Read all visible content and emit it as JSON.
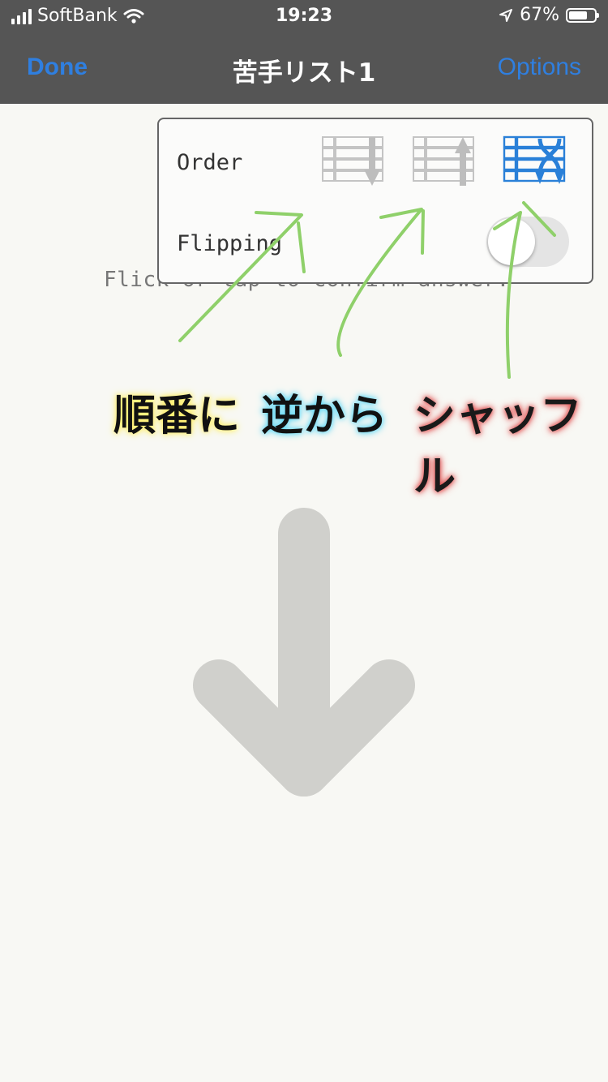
{
  "status_bar": {
    "carrier": "SoftBank",
    "time": "19:23",
    "battery": "67%"
  },
  "nav": {
    "done_label": "Done",
    "title": "苦手リスト1",
    "options_label": "Options"
  },
  "hint_text": "Flick or tap to confirm answer.",
  "popover": {
    "order_label": "Order",
    "flipping_label": "Flipping",
    "order_options": [
      "sequential",
      "reverse",
      "shuffle"
    ],
    "selected_order": "shuffle",
    "flipping_enabled": false
  },
  "annotations": {
    "sequential": "順番に",
    "reverse": "逆から",
    "shuffle": "シャッフル"
  },
  "colors": {
    "accent": "#2f7fe0",
    "annotation_stroke": "#8fd06a",
    "arrow": "#d0d0cc"
  }
}
